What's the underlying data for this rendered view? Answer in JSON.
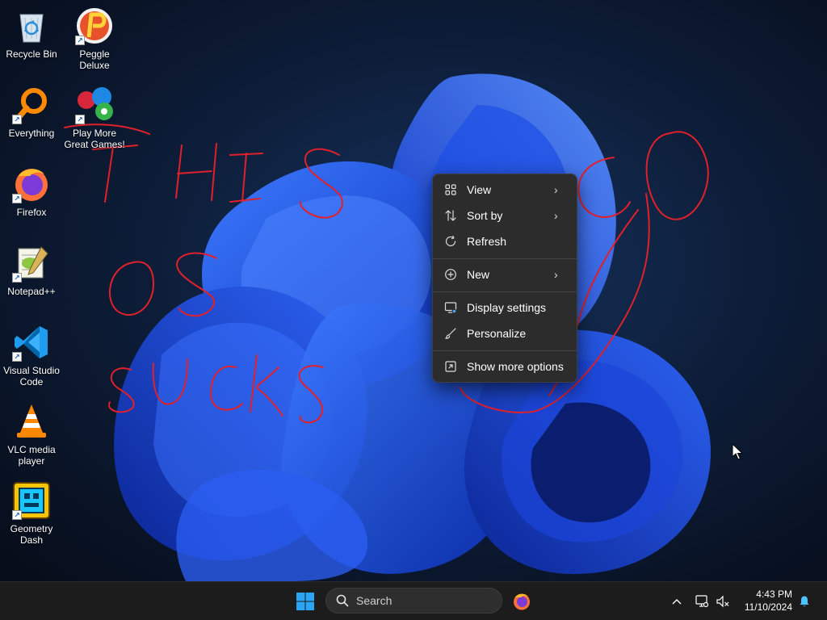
{
  "desktop": {
    "icons": [
      {
        "label": "Recycle Bin",
        "icon": "recycle-bin-icon"
      },
      {
        "label": "Peggle Deluxe",
        "icon": "peggle-icon"
      },
      {
        "label": "Everything",
        "icon": "everything-search-icon"
      },
      {
        "label": "Play More Great Games!",
        "icon": "play-more-games-icon"
      },
      {
        "label": "Firefox",
        "icon": "firefox-icon"
      },
      {
        "label": "Notepad++",
        "icon": "notepad-plus-plus-icon"
      },
      {
        "label": "Visual Studio Code",
        "icon": "vscode-icon"
      },
      {
        "label": "VLC media player",
        "icon": "vlc-icon"
      },
      {
        "label": "Geometry Dash",
        "icon": "geometry-dash-icon"
      }
    ],
    "scribble_text": "THIS OS SUCKS"
  },
  "context_menu": {
    "items": [
      {
        "label": "View",
        "icon": "view-grid-icon",
        "submenu": true
      },
      {
        "label": "Sort by",
        "icon": "sort-icon",
        "submenu": true
      },
      {
        "label": "Refresh",
        "icon": "refresh-icon",
        "submenu": false
      },
      {
        "label": "New",
        "icon": "new-plus-icon",
        "submenu": true
      },
      {
        "label": "Display settings",
        "icon": "display-settings-icon",
        "submenu": false
      },
      {
        "label": "Personalize",
        "icon": "personalize-brush-icon",
        "submenu": false
      },
      {
        "label": "Show more options",
        "icon": "show-more-options-icon",
        "submenu": false
      }
    ]
  },
  "taskbar": {
    "search_placeholder": "Search",
    "time": "4:43 PM",
    "date": "11/10/2024"
  },
  "colors": {
    "accent": "#0078d4",
    "scribble": "#e0202a",
    "taskbar": "#1c1c1c",
    "menu": "#2c2c2c"
  }
}
